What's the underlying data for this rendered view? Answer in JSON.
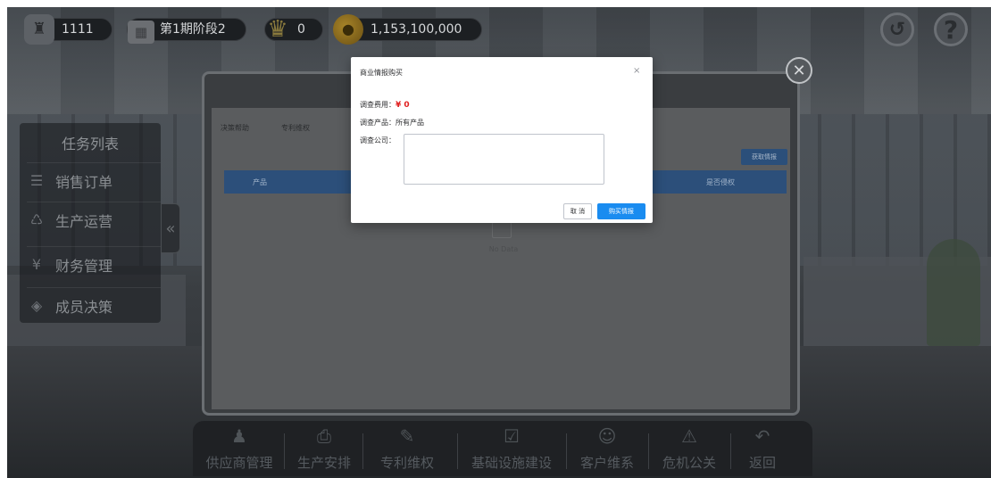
{
  "status_bar": {
    "user_id": "1111",
    "period": "第1期阶段2",
    "trophy_count": "0",
    "money": "1,153,100,000",
    "history_icon": "history-icon",
    "help_icon": "?"
  },
  "sidebar": {
    "title": "任务列表",
    "items": [
      {
        "label": "销售订单",
        "icon": "document-icon",
        "glyph": "☰"
      },
      {
        "label": "生产运营",
        "icon": "recycle-icon",
        "glyph": "♺"
      },
      {
        "label": "财务管理",
        "icon": "yen-icon",
        "glyph": "¥"
      },
      {
        "label": "成员决策",
        "icon": "layers-icon",
        "glyph": "◈"
      }
    ],
    "collapse_glyph": "«"
  },
  "main_panel": {
    "tabs": [
      "决策帮助",
      "专利维权"
    ],
    "table_headers": [
      "产品",
      "是否侵权"
    ],
    "action_button": "获取情报",
    "empty_text": "No Data"
  },
  "toolbar": {
    "items": [
      {
        "label": "供应商管理",
        "icon": "supplier-icon",
        "glyph": "♟"
      },
      {
        "label": "生产安排",
        "icon": "printer-icon",
        "glyph": "⎙"
      },
      {
        "label": "专利维权",
        "icon": "patent-icon",
        "glyph": "✎"
      },
      {
        "label": "基础设施建设",
        "icon": "checklist-icon",
        "glyph": "☑"
      },
      {
        "label": "客户维系",
        "icon": "customer-icon",
        "glyph": "☺"
      },
      {
        "label": "危机公关",
        "icon": "alarm-icon",
        "glyph": "⚠"
      },
      {
        "label": "返回",
        "icon": "back-arrow-icon",
        "glyph": "↶"
      }
    ]
  },
  "dialog": {
    "title": "商业情报购买",
    "close": "×",
    "fee_label": "调查费用：",
    "fee_value": "¥ 0",
    "product_label": "调查产品：",
    "product_value": "所有产品",
    "company_label": "调查公司：",
    "company_value": "",
    "cancel_label": "取 消",
    "buy_label": "购买情报"
  },
  "colors": {
    "primary_blue": "#1a8cf0",
    "fee_red": "#e02020",
    "table_header": "#2c4f7a"
  }
}
